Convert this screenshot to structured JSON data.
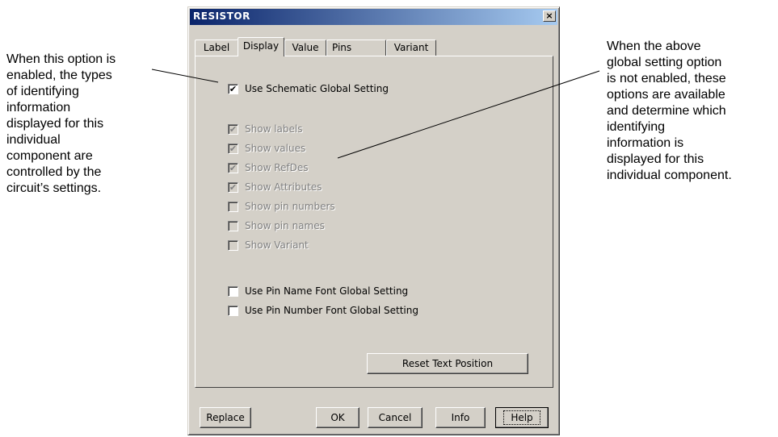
{
  "annotations": {
    "left": [
      "When this option is",
      "enabled, the types",
      "of identifying",
      "information",
      "displayed for this",
      "individual",
      "component are",
      "controlled by the",
      "circuit’s settings."
    ],
    "right": [
      "When the above",
      "global setting option",
      "is not enabled, these",
      "options are available",
      "and determine which",
      "identifying",
      "information is",
      "displayed for this",
      "individual component."
    ]
  },
  "dialog": {
    "title": "RESISTOR",
    "close_glyph": "×",
    "tabs": [
      "Label",
      "Display",
      "Value",
      "Pins",
      "Variant"
    ],
    "active_tab": "Display",
    "global_setting": {
      "label": "Use Schematic Global Setting",
      "checked": true
    },
    "show_options": [
      {
        "label": "Show labels",
        "checked": true,
        "enabled": false
      },
      {
        "label": "Show values",
        "checked": true,
        "enabled": false
      },
      {
        "label": "Show RefDes",
        "checked": true,
        "enabled": false
      },
      {
        "label": "Show Attributes",
        "checked": true,
        "enabled": false
      },
      {
        "label": "Show pin numbers",
        "checked": false,
        "enabled": false
      },
      {
        "label": "Show pin names",
        "checked": false,
        "enabled": false
      },
      {
        "label": "Show Variant",
        "checked": false,
        "enabled": false
      }
    ],
    "font_options": [
      {
        "label": "Use Pin Name Font Global Setting",
        "checked": false
      },
      {
        "label": "Use Pin Number Font Global Setting",
        "checked": false
      }
    ],
    "reset_button": "Reset Text Position",
    "buttons": {
      "replace": "Replace",
      "ok": "OK",
      "cancel": "Cancel",
      "info": "Info",
      "help": "Help"
    },
    "check_glyph": "✔"
  },
  "colors": {
    "dialog_bg": "#d4d0c8",
    "titlebar_start": "#0a246a",
    "titlebar_end": "#a6caf0",
    "disabled_text": "#808080"
  }
}
